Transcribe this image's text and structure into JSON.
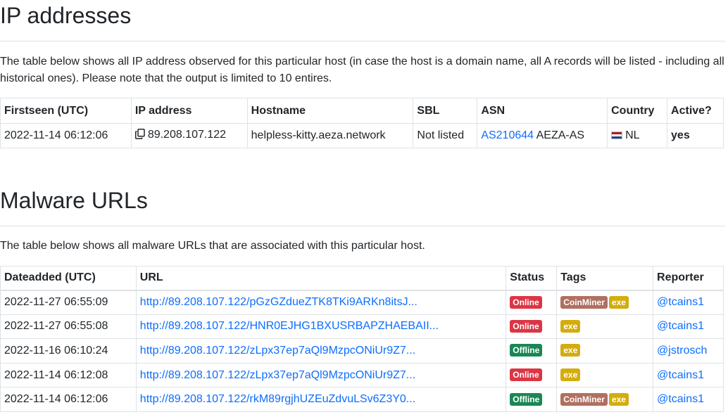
{
  "ip_section": {
    "title": "IP addresses",
    "description": "The table below shows all IP address observed for this particular host (in case the host is a domain name, all A records will be listed - including all historical ones). Please note that the output is limited to 10 entires.",
    "columns": [
      "Firstseen (UTC)",
      "IP address",
      "Hostname",
      "SBL",
      "ASN",
      "Country",
      "Active?"
    ],
    "rows": [
      {
        "firstseen": "2022-11-14 06:12:06",
        "ip": "89.208.107.122",
        "hostname": "helpless-kitty.aeza.network",
        "sbl": "Not listed",
        "asn_link": "AS210644",
        "asn_name": "AEZA-AS",
        "country": "NL",
        "country_flag": "netherlands-flag-icon",
        "active": "yes"
      }
    ]
  },
  "malware_section": {
    "title": "Malware URLs",
    "description": "The table below shows all malware URLs that are associated with this particular host.",
    "columns": [
      "Dateadded (UTC)",
      "URL",
      "Status",
      "Tags",
      "Reporter"
    ],
    "rows": [
      {
        "date": "2022-11-27 06:55:09",
        "url": "http://89.208.107.122/pGzGZdueZTK8TKi9ARKn8itsJ...",
        "status": "Online",
        "tags": [
          "CoinMiner",
          "exe"
        ],
        "reporter": "@tcains1"
      },
      {
        "date": "2022-11-27 06:55:08",
        "url": "http://89.208.107.122/HNR0EJHG1BXUSRBAPZHAEBAII...",
        "status": "Online",
        "tags": [
          "exe"
        ],
        "reporter": "@tcains1"
      },
      {
        "date": "2022-11-16 06:10:24",
        "url": "http://89.208.107.122/zLpx37ep7aQl9MzpcONiUr9Z7...",
        "status": "Offline",
        "tags": [
          "exe"
        ],
        "reporter": "@jstrosch"
      },
      {
        "date": "2022-11-14 06:12:08",
        "url": "http://89.208.107.122/zLpx37ep7aQl9MzpcONiUr9Z7...",
        "status": "Online",
        "tags": [
          "exe"
        ],
        "reporter": "@tcains1"
      },
      {
        "date": "2022-11-14 06:12:06",
        "url": "http://89.208.107.122/rkM89rgjhUZEuZdvuLSv6Z3Y0...",
        "status": "Offline",
        "tags": [
          "CoinMiner",
          "exe"
        ],
        "reporter": "@tcains1"
      }
    ]
  },
  "colors": {
    "link": "#0d6efd",
    "online": "#dc3545",
    "offline": "#198754",
    "coinminer": "#b07060",
    "exe": "#d4ac0d"
  }
}
